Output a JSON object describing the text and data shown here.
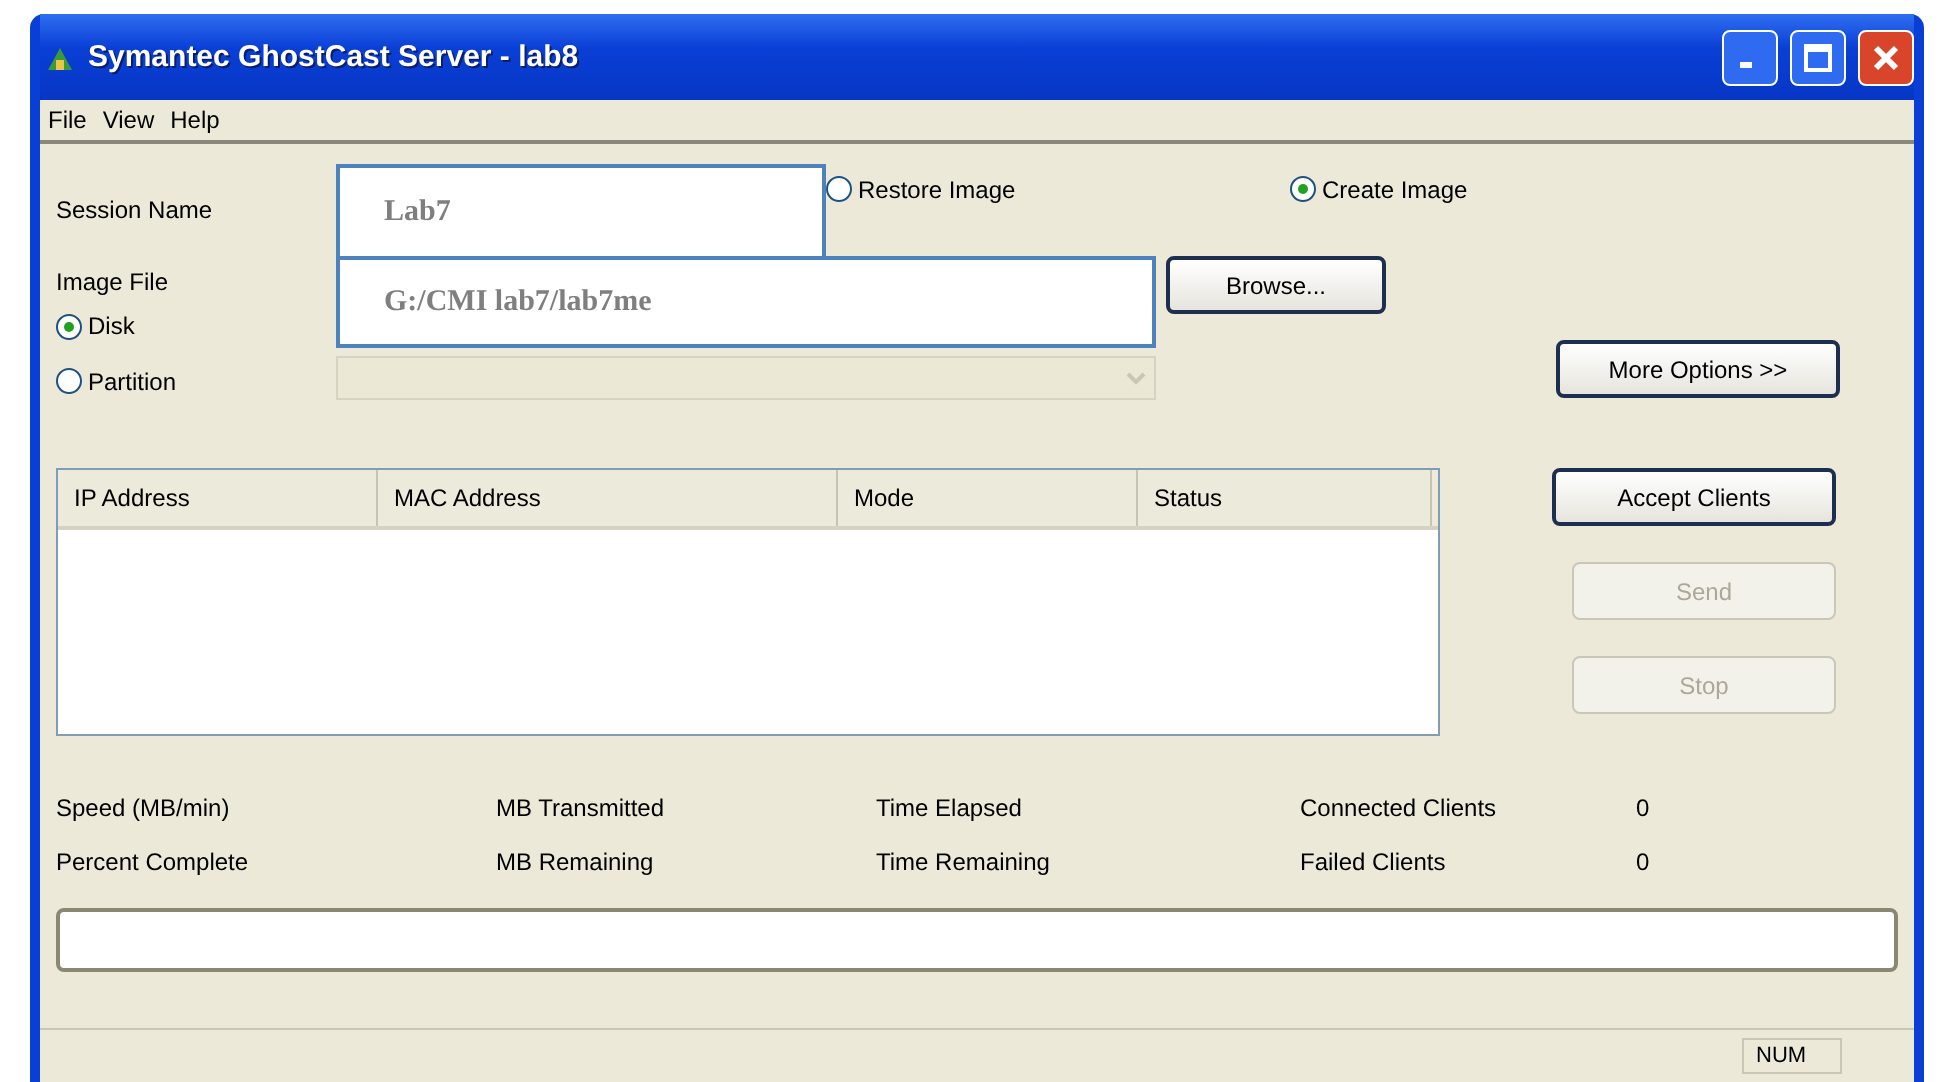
{
  "window": {
    "title": "Symantec GhostCast Server - lab8"
  },
  "menu": [
    "File",
    "View",
    "Help"
  ],
  "session": {
    "label": "Session Name",
    "value": "Lab7"
  },
  "mode_options": [
    {
      "label": "Restore Image",
      "selected": false
    },
    {
      "label": "Create Image",
      "selected": true
    }
  ],
  "image_file": {
    "label": "Image File",
    "value": "G:/CMI lab7/lab7me"
  },
  "browse_button": {
    "label": "Browse..."
  },
  "target_options": [
    {
      "label": "Disk",
      "selected": true
    },
    {
      "label": "Partition",
      "selected": false
    }
  ],
  "partition_dropdown": {
    "disabled": true
  },
  "more_options_button": {
    "label": "More Options >>",
    "disabled": false
  },
  "client_table": {
    "columns": [
      "IP Address",
      "MAC Address",
      "Mode",
      "Status"
    ]
  },
  "action_buttons": [
    {
      "label": "Accept Clients",
      "disabled": false
    },
    {
      "label": "Send",
      "disabled": true
    },
    {
      "label": "Stop",
      "disabled": true
    }
  ],
  "stats": [
    [
      {
        "label": "Speed (MB/min)"
      },
      {
        "label": "MB Transmitted"
      },
      {
        "label": "Time Elapsed"
      },
      {
        "label": "Connected Clients",
        "value": "0"
      }
    ],
    [
      {
        "label": "Percent Complete"
      },
      {
        "label": "MB Remaining"
      },
      {
        "label": "Time Remaining"
      },
      {
        "label": "Failed Clients",
        "value": "0"
      }
    ]
  ],
  "progress": {
    "level": 0
  },
  "status_bar": {
    "indicator": "NUM"
  }
}
